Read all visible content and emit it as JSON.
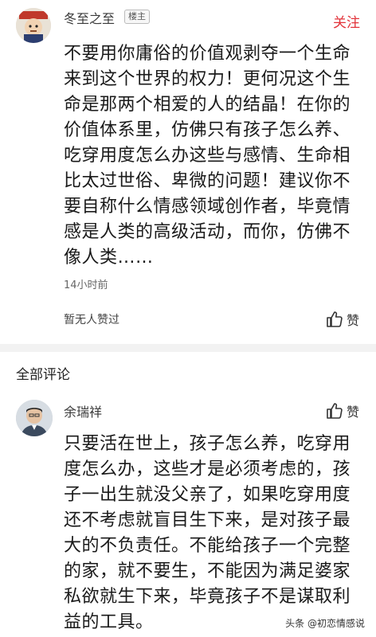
{
  "post": {
    "username": "冬至之至",
    "badge": "楼主",
    "follow_label": "关注",
    "text_lines": [
      "不要用你庸俗的价值观剥夺一个生命",
      "来到这个世界的权力！更何况这个生",
      "命是那两个相爱的人的结晶！在你的",
      "价值体系里，仿佛只有孩子怎么养、",
      "吃穿用度怎么办这些与感情、生命相",
      "比太过世俗、卑微的问题！建议你不",
      "要自称什么情感领域创作者，毕竟情",
      "感是人类的高级活动，而你，仿佛不",
      "像人类……"
    ],
    "time": "14小时前",
    "no_likes": "暂无人赞过",
    "like_label": "赞"
  },
  "comments_section": {
    "title": "全部评论"
  },
  "comment": {
    "username": "余瑞祥",
    "like_label": "赞",
    "text_lines": [
      "只要活在世上，孩子怎么养，吃穿用",
      "度怎么办，这些才是必须考虑的，孩",
      "子一出生就没父亲了，如果吃穿用度",
      "还不考虑就盲目生下来，是对孩子最",
      "大的不负责任。不能给孩子一个完整",
      "的家，就不要生，不能因为满足婆家",
      "私欲就生下来，毕竟孩子不是谋取利",
      "益的工具。"
    ]
  },
  "watermark": {
    "text": "头条 @初恋情感说"
  },
  "colors": {
    "follow": "#e2333a",
    "divider": "#f2f2f2"
  }
}
